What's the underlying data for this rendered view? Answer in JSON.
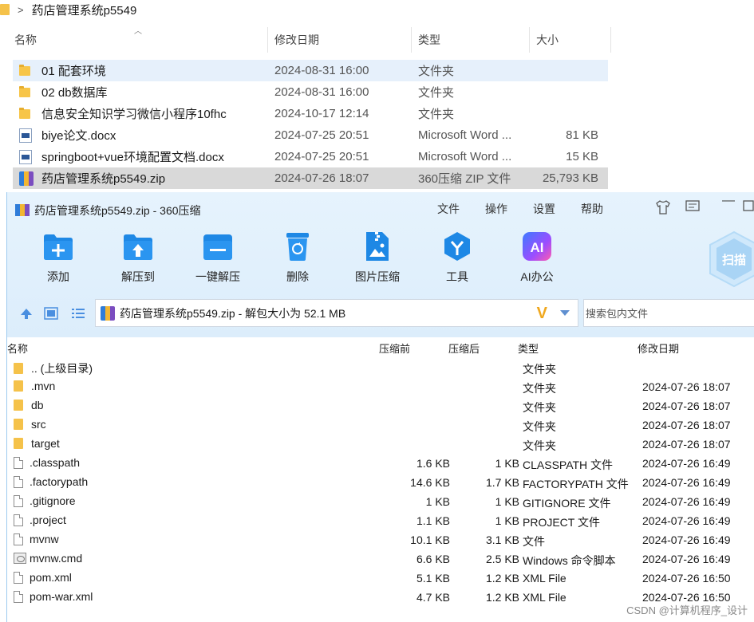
{
  "explorer": {
    "breadcrumb": "药店管理系统p5549",
    "columns": {
      "name": "名称",
      "date": "修改日期",
      "type": "类型",
      "size": "大小"
    },
    "files": [
      {
        "name": "01 配套环境",
        "date": "2024-08-31 16:00",
        "type": "文件夹",
        "size": "",
        "icon": "folder-icon"
      },
      {
        "name": "02 db数据库",
        "date": "2024-08-31 16:00",
        "type": "文件夹",
        "size": "",
        "icon": "folder-icon"
      },
      {
        "name": "信息安全知识学习微信小程序10fhc",
        "date": "2024-10-17 12:14",
        "type": "文件夹",
        "size": "",
        "icon": "folder-icon"
      },
      {
        "name": "biye论文.docx",
        "date": "2024-07-25 20:51",
        "type": "Microsoft Word ...",
        "size": "81 KB",
        "icon": "word-icon"
      },
      {
        "name": "springboot+vue环境配置文档.docx",
        "date": "2024-07-25 20:51",
        "type": "Microsoft Word ...",
        "size": "15 KB",
        "icon": "word-icon"
      },
      {
        "name": "药店管理系统p5549.zip",
        "date": "2024-07-26 18:07",
        "type": "360压缩 ZIP 文件",
        "size": "25,793 KB",
        "icon": "zip-icon"
      }
    ]
  },
  "zip": {
    "title": "药店管理系统p5549.zip - 360压缩",
    "menu": [
      "文件",
      "操作",
      "设置",
      "帮助"
    ],
    "tools": [
      "添加",
      "解压到",
      "一键解压",
      "删除",
      "图片压缩",
      "工具",
      "AI办公"
    ],
    "scan_label": "扫描",
    "ai_label": "AI",
    "address": "药店管理系统p5549.zip - 解包大小为 52.1 MB",
    "search_placeholder": "搜索包内文件",
    "columns": {
      "name": "名称",
      "packed_before": "压缩前",
      "packed_after": "压缩后",
      "type": "类型",
      "date": "修改日期"
    },
    "entries": [
      {
        "name": ".. (上级目录)",
        "before": "",
        "after": "",
        "type": "文件夹",
        "date": "",
        "icon": "folder"
      },
      {
        "name": ".mvn",
        "before": "",
        "after": "",
        "type": "文件夹",
        "date": "2024-07-26 18:07",
        "icon": "folder"
      },
      {
        "name": "db",
        "before": "",
        "after": "",
        "type": "文件夹",
        "date": "2024-07-26 18:07",
        "icon": "folder"
      },
      {
        "name": "src",
        "before": "",
        "after": "",
        "type": "文件夹",
        "date": "2024-07-26 18:07",
        "icon": "folder"
      },
      {
        "name": "target",
        "before": "",
        "after": "",
        "type": "文件夹",
        "date": "2024-07-26 18:07",
        "icon": "folder"
      },
      {
        "name": ".classpath",
        "before": "1.6 KB",
        "after": "1 KB",
        "type": "CLASSPATH 文件",
        "date": "2024-07-26 16:49",
        "icon": "file"
      },
      {
        "name": ".factorypath",
        "before": "14.6 KB",
        "after": "1.7 KB",
        "type": "FACTORYPATH 文件",
        "date": "2024-07-26 16:49",
        "icon": "file"
      },
      {
        "name": ".gitignore",
        "before": "1 KB",
        "after": "1 KB",
        "type": "GITIGNORE 文件",
        "date": "2024-07-26 16:49",
        "icon": "file"
      },
      {
        "name": ".project",
        "before": "1.1 KB",
        "after": "1 KB",
        "type": "PROJECT 文件",
        "date": "2024-07-26 16:49",
        "icon": "file"
      },
      {
        "name": "mvnw",
        "before": "10.1 KB",
        "after": "3.1 KB",
        "type": "文件",
        "date": "2024-07-26 16:49",
        "icon": "file"
      },
      {
        "name": "mvnw.cmd",
        "before": "6.6 KB",
        "after": "2.5 KB",
        "type": "Windows 命令脚本",
        "date": "2024-07-26 16:49",
        "icon": "cmd"
      },
      {
        "name": "pom.xml",
        "before": "5.1 KB",
        "after": "1.2 KB",
        "type": "XML File",
        "date": "2024-07-26 16:50",
        "icon": "file"
      },
      {
        "name": "pom-war.xml",
        "before": "4.7 KB",
        "after": "1.2 KB",
        "type": "XML File",
        "date": "2024-07-26 16:50",
        "icon": "file"
      }
    ]
  },
  "watermark": "CSDN @计算机程序_设计",
  "colors": {
    "accent": "#1e88e5",
    "toolbar_bg": "#e2f0fc",
    "selection": "#e6f0fb"
  }
}
